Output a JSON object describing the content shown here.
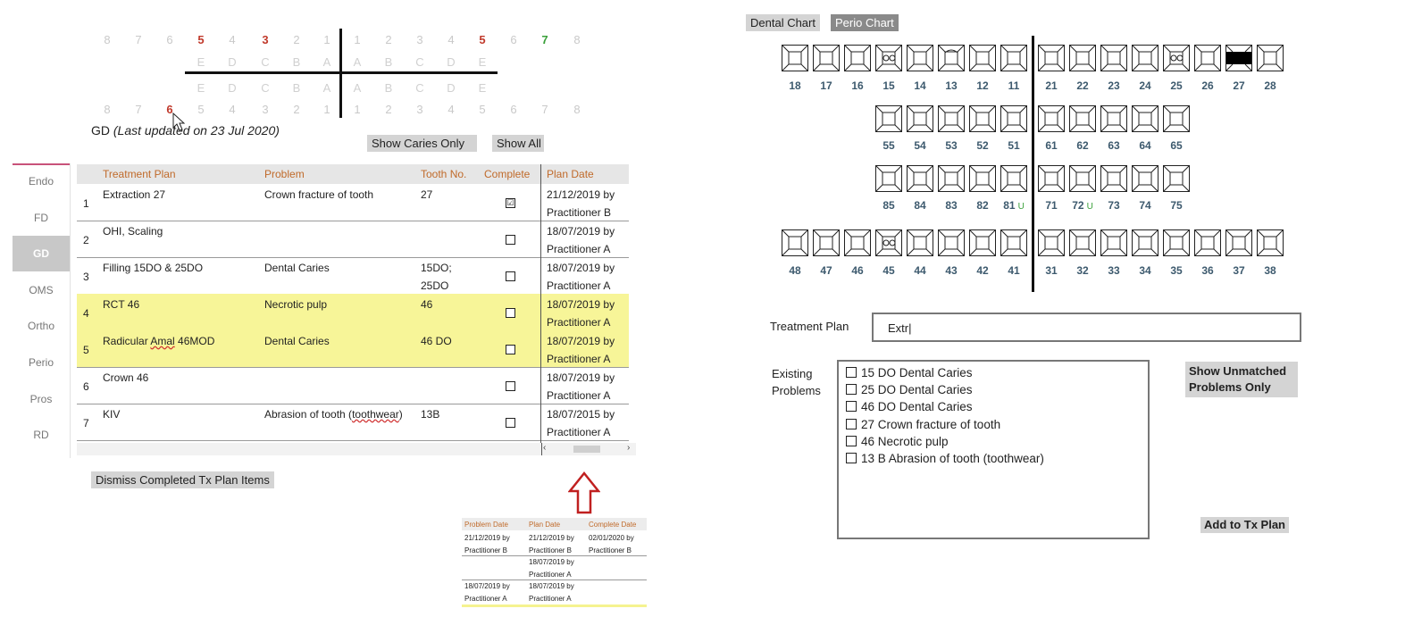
{
  "quadrant": {
    "upper_right": [
      "8",
      "7",
      "6",
      "5",
      "4",
      "3",
      "2",
      "1"
    ],
    "upper_left": [
      "1",
      "2",
      "3",
      "4",
      "5",
      "6",
      "7",
      "8"
    ],
    "primary_upper_right": [
      "E",
      "D",
      "C",
      "B",
      "A"
    ],
    "primary_upper_left": [
      "A",
      "B",
      "C",
      "D",
      "E"
    ],
    "primary_lower_right": [
      "E",
      "D",
      "C",
      "B",
      "A"
    ],
    "primary_lower_left": [
      "A",
      "B",
      "C",
      "D",
      "E"
    ],
    "lower_right": [
      "8",
      "7",
      "6",
      "5",
      "4",
      "3",
      "2",
      "1"
    ],
    "lower_left": [
      "1",
      "2",
      "3",
      "4",
      "5",
      "6",
      "7",
      "8"
    ]
  },
  "gd_status": {
    "prefix": "GD ",
    "italic": "(Last updated on 23 Jul 2020)"
  },
  "buttons": {
    "show_caries": "Show Caries Only",
    "show_all": "Show All",
    "dismiss": "Dismiss Completed Tx Plan Items",
    "dental_chart": "Dental Chart",
    "perio_chart": "Perio Chart",
    "show_unmatched": "Show Unmatched Problems Only",
    "add_tx": "Add to Tx Plan"
  },
  "sidebar": [
    "Endo",
    "FD",
    "GD",
    "OMS",
    "Ortho",
    "Perio",
    "Pros",
    "RD"
  ],
  "table": {
    "headers": [
      "Treatment Plan",
      "Problem",
      "Tooth No.",
      "Complete",
      "Plan Date"
    ],
    "rows": [
      {
        "n": "1",
        "plan": "Extraction 27",
        "problem": "Crown fracture of tooth",
        "tooth": "27",
        "tooth2": "",
        "complete": "☑",
        "date1": "21/12/2019 by",
        "date2": "Practitioner B",
        "hl": false
      },
      {
        "n": "2",
        "plan": "OHI, Scaling",
        "problem": "",
        "tooth": "",
        "tooth2": "",
        "complete": "",
        "date1": "18/07/2019 by",
        "date2": "Practitioner A",
        "hl": false
      },
      {
        "n": "3",
        "plan": "Filling 15DO & 25DO",
        "problem": "Dental Caries",
        "tooth": "15DO;",
        "tooth2": "25DO",
        "complete": "",
        "date1": "18/07/2019 by",
        "date2": "Practitioner A",
        "hl": false
      },
      {
        "n": "4",
        "plan": "RCT 46",
        "problem": "Necrotic pulp",
        "tooth": "46",
        "tooth2": "",
        "complete": "",
        "date1": "18/07/2019 by",
        "date2": "Practitioner A",
        "hl": true
      },
      {
        "n": "5",
        "plan": "Radicular Amal 46MOD",
        "problem": "Dental Caries",
        "tooth": "46 DO",
        "tooth2": "",
        "complete": "",
        "date1": "18/07/2019 by",
        "date2": "Practitioner A",
        "hl": true
      },
      {
        "n": "6",
        "plan": "Crown 46",
        "problem": "",
        "tooth": "",
        "tooth2": "",
        "complete": "",
        "date1": "18/07/2019 by",
        "date2": "Practitioner A",
        "hl": false
      },
      {
        "n": "7",
        "plan": "KIV",
        "problem": "Abrasion of tooth (toothwear)",
        "tooth": "13B",
        "tooth2": "",
        "complete": "",
        "date1": "18/07/2015 by",
        "date2": "Practitioner A",
        "hl": false
      }
    ]
  },
  "snippet": {
    "headers": [
      "Problem Date",
      "Plan Date",
      "Complete Date"
    ],
    "rows": [
      [
        "21/12/2019 by",
        "21/12/2019 by",
        "02/01/2020 by"
      ],
      [
        "Practitioner B",
        "Practitioner B",
        "Practitioner B"
      ],
      [
        "",
        "18/07/2019 by",
        ""
      ],
      [
        "",
        "Practitioner A",
        ""
      ],
      [
        "18/07/2019 by",
        "18/07/2019 by",
        ""
      ],
      [
        "Practitioner A",
        "Practitioner A",
        ""
      ]
    ]
  },
  "chart": {
    "row1": [
      "18",
      "17",
      "16",
      "15",
      "14",
      "13",
      "12",
      "11",
      "21",
      "22",
      "23",
      "24",
      "25",
      "26",
      "27",
      "28"
    ],
    "row2": [
      "55",
      "54",
      "53",
      "52",
      "51",
      "61",
      "62",
      "63",
      "64",
      "65"
    ],
    "row3": [
      "85",
      "84",
      "83",
      "82",
      "81",
      "71",
      "72",
      "73",
      "74",
      "75"
    ],
    "row4": [
      "48",
      "47",
      "46",
      "45",
      "44",
      "43",
      "42",
      "41",
      "31",
      "32",
      "33",
      "34",
      "35",
      "36",
      "37",
      "38"
    ],
    "u_mark": "U"
  },
  "form": {
    "tx_label": "Treatment Plan",
    "tx_value": "Extr|",
    "existing_label1": "Existing",
    "existing_label2": "Problems",
    "problems": [
      "15 DO  Dental Caries",
      "25 DO  Dental Caries",
      "46 DO  Dental Caries",
      "27 Crown fracture of tooth",
      "46 Necrotic pulp",
      "13 B Abrasion of tooth (toothwear)"
    ]
  }
}
